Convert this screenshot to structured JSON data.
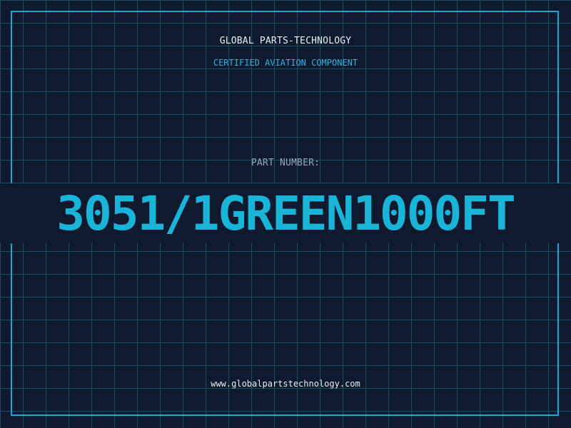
{
  "header": {
    "company": "GLOBAL PARTS-TECHNOLOGY",
    "subtitle": "CERTIFIED AVIATION COMPONENT"
  },
  "part": {
    "label": "PART NUMBER:",
    "number": "3051/1GREEN1000FT"
  },
  "footer": {
    "website": "www.globalpartstechnology.com"
  },
  "colors": {
    "background": "#0f1a2e",
    "grid": "#1d4a63",
    "accent": "#1ab4d8",
    "frame": "#1aa8cf",
    "text": "#e8eef5",
    "muted": "#9aa6b8"
  }
}
